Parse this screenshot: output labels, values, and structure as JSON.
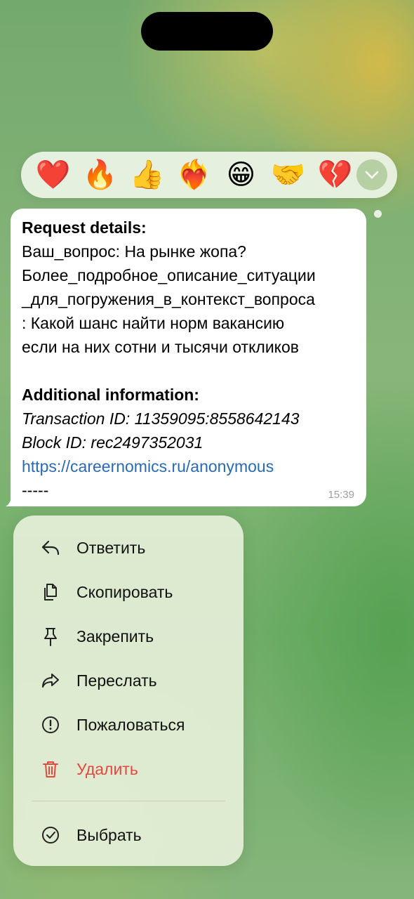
{
  "reactions": [
    {
      "emoji": "❤️",
      "icon": "red-heart-icon"
    },
    {
      "emoji": "🔥",
      "icon": "fire-icon"
    },
    {
      "emoji": "👍",
      "icon": "thumbs-up-icon"
    },
    {
      "emoji": "❤️‍🔥",
      "icon": "heart-on-fire-icon"
    },
    {
      "emoji": "😁",
      "icon": "beaming-face-icon"
    },
    {
      "emoji": "🤝",
      "icon": "handshake-icon"
    },
    {
      "emoji": "💔",
      "icon": "broken-heart-icon"
    }
  ],
  "message": {
    "header": "Request details:",
    "lines": [
      "Ваш_вопрос: На рынке жопа?",
      "Более_подробное_описание_ситуации",
      "_для_погружения_в_контекст_вопроса",
      ": Какой шанс  найти норм вакансию",
      "если на них сотни и тысячи откликов"
    ],
    "additional_header": "Additional information:",
    "transaction": "Transaction ID: 11359095:8558642143",
    "block": "Block ID: rec2497352031",
    "link": "https://careernomics.ru/anonymous",
    "separator": "-----",
    "time": "15:39"
  },
  "menu": {
    "items": [
      {
        "label": "Ответить",
        "icon": "reply-icon"
      },
      {
        "label": "Скопировать",
        "icon": "copy-icon"
      },
      {
        "label": "Закрепить",
        "icon": "pin-icon"
      },
      {
        "label": "Переслать",
        "icon": "forward-icon"
      },
      {
        "label": "Пожаловаться",
        "icon": "report-icon"
      },
      {
        "label": "Удалить",
        "icon": "trash-icon"
      },
      {
        "label": "Выбрать",
        "icon": "select-check-icon"
      }
    ]
  },
  "colors": {
    "danger": "#e5483f",
    "link": "#2a6ab3",
    "expand_button": "#b6cfa3"
  }
}
